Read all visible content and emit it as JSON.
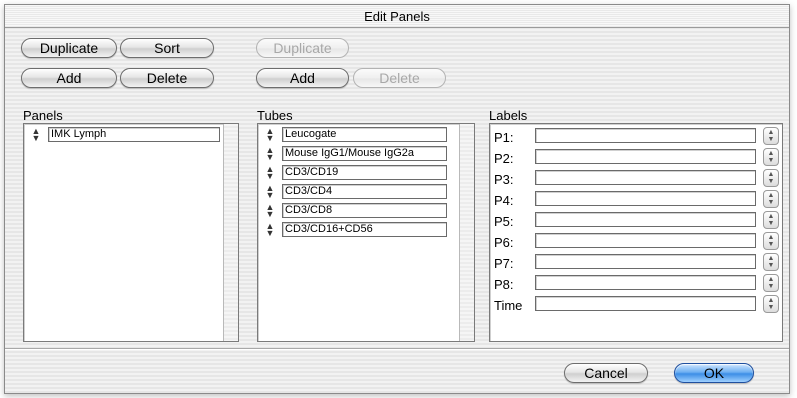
{
  "window": {
    "title": "Edit Panels"
  },
  "panel_buttons": {
    "duplicate": "Duplicate",
    "sort": "Sort",
    "add": "Add",
    "delete": "Delete"
  },
  "tube_buttons": {
    "duplicate": "Duplicate",
    "add": "Add",
    "delete": "Delete"
  },
  "sections": {
    "panels": "Panels",
    "tubes": "Tubes",
    "labels": "Labels"
  },
  "panels": [
    "IMK Lymph"
  ],
  "tubes": [
    "Leucogate",
    "Mouse IgG1/Mouse IgG2a",
    "CD3/CD19",
    "CD3/CD4",
    "CD3/CD8",
    "CD3/CD16+CD56"
  ],
  "labels": [
    {
      "name": "P1:",
      "value": ""
    },
    {
      "name": "P2:",
      "value": ""
    },
    {
      "name": "P3:",
      "value": ""
    },
    {
      "name": "P4:",
      "value": ""
    },
    {
      "name": "P5:",
      "value": ""
    },
    {
      "name": "P6:",
      "value": ""
    },
    {
      "name": "P7:",
      "value": ""
    },
    {
      "name": "P8:",
      "value": ""
    },
    {
      "name": "Time",
      "value": ""
    }
  ],
  "footer": {
    "cancel": "Cancel",
    "ok": "OK"
  },
  "icons": {
    "row_grip": "up-down-arrows-icon",
    "stepper": "stepper-arrows-icon"
  },
  "colors": {
    "default_button": "#3d8ee6",
    "window_stripe_light": "#f2f2f2",
    "window_stripe_dark": "#e6e6e6"
  }
}
